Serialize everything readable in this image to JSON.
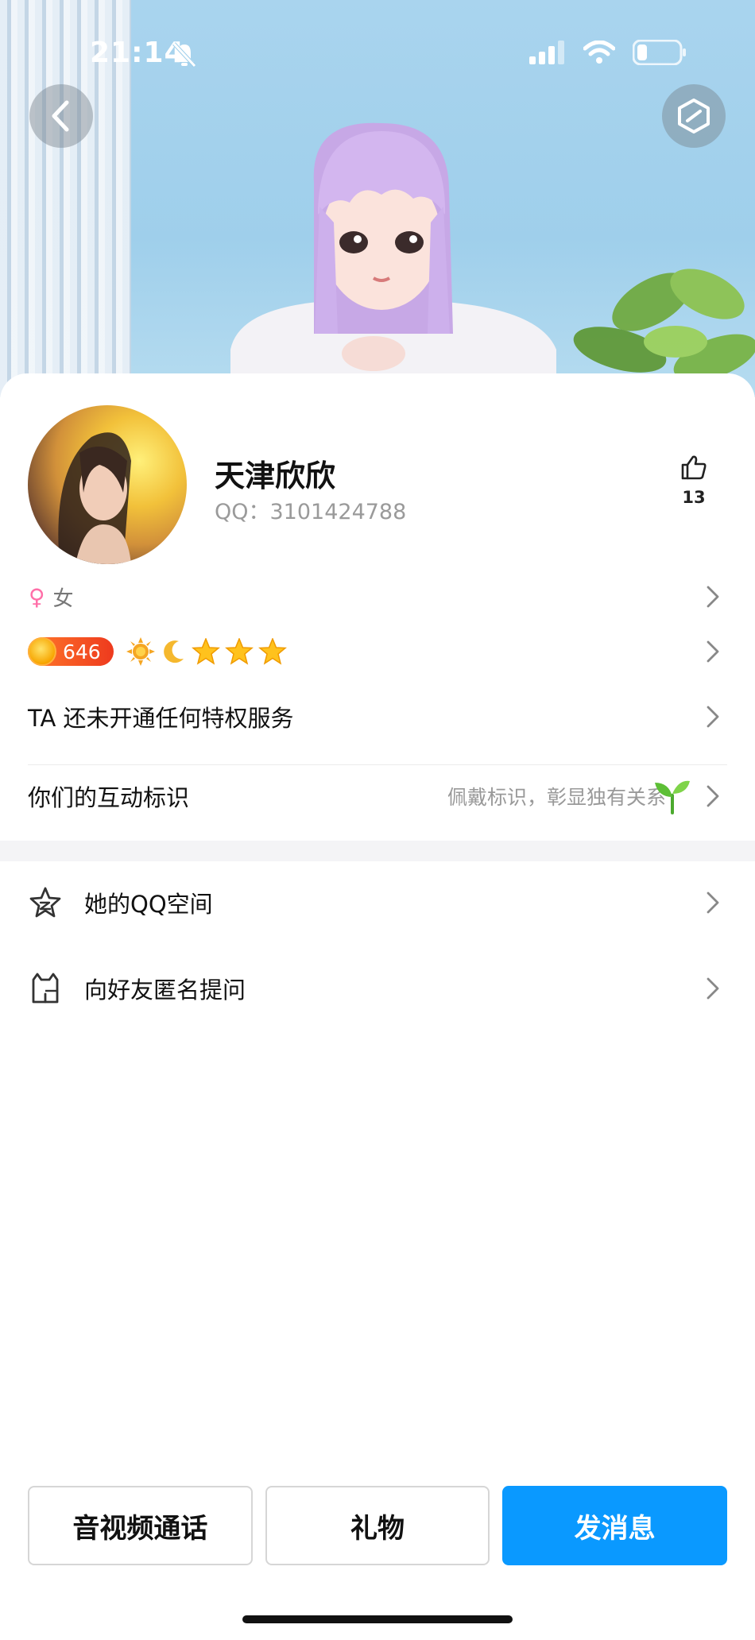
{
  "status_bar": {
    "time": "21:14",
    "icons": [
      "bell-mute-icon",
      "signal-icon",
      "wifi-icon",
      "battery-icon"
    ]
  },
  "header": {
    "icons": [
      "back-icon",
      "skin-icon"
    ]
  },
  "profile": {
    "nickname": "天津欣欣",
    "qq_label": "QQ：3101424788",
    "likes": "13",
    "gender_symbol": "♀",
    "gender": "女",
    "level": "646",
    "level_icons": [
      "sun-icon",
      "moon-icon",
      "star-icon",
      "star-icon",
      "star-icon"
    ]
  },
  "rows": {
    "privilege": "TA 还未开通任何特权服务",
    "interaction_title": "你们的互动标识",
    "interaction_hint": "佩戴标识，彰显独有关系"
  },
  "list": {
    "qzone": "她的QQ空间",
    "ask": "向好友匿名提问"
  },
  "buttons": {
    "call": "音视频通话",
    "gift": "礼物",
    "message": "发消息"
  },
  "colors": {
    "primary": "#0a99ff",
    "level_badge": "#ee3a1e",
    "gender": "#ff6fa8"
  }
}
